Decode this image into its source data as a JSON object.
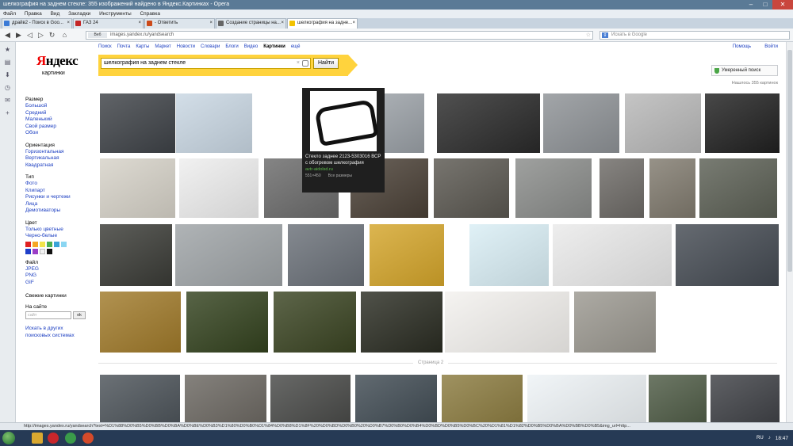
{
  "window": {
    "title": "шелкография на заднем стекле: 355 изображений найдено в Яндекс.Картинках - Opera"
  },
  "menu": [
    "Файл",
    "Правка",
    "Вид",
    "Закладки",
    "Инструменты",
    "Справка"
  ],
  "tabs": [
    {
      "label": "драйв2 - Поиск в Goo...",
      "color": "#3a7ad6"
    },
    {
      "label": "ГАЗ 24",
      "color": "#c42525"
    },
    {
      "label": "- Ответить",
      "color": "#cc4a1a"
    },
    {
      "label": "Создание страницы на...",
      "color": "#666666"
    },
    {
      "label": "шелкография на задне...",
      "color": "#f2c200",
      "active": true
    }
  ],
  "address": {
    "badge": "Веб",
    "url": "images.yandex.ru/yandsearch",
    "websearch_placeholder": "Искать в Google"
  },
  "yandex": {
    "logo_first": "Я",
    "logo_rest": "ндекс",
    "logo_sub": "картинки",
    "services": [
      "Поиск",
      "Почта",
      "Карты",
      "Маркет",
      "Новости",
      "Словари",
      "Блоги",
      "Видео",
      "Картинки",
      "ещё"
    ],
    "active_service": "Картинки",
    "help": "Помощь",
    "login": "Войти",
    "query": "шелкография на заднем стекле",
    "find_button": "Найти",
    "safe_search": "Умеренный поиск",
    "found": "Нашлось 355 картинок"
  },
  "sidebar": {
    "size_title": "Размер",
    "size_items": [
      "Большой",
      "Средний",
      "Маленький",
      "Свой размер",
      "Обои"
    ],
    "orient_title": "Ориентация",
    "orient_items": [
      "Горизонтальная",
      "Вертикальная",
      "Квадратная"
    ],
    "type_title": "Тип",
    "type_items": [
      "Фото",
      "Клипарт",
      "Рисунки и чертежи",
      "Лица",
      "Демотиваторы"
    ],
    "color_title": "Цвет",
    "color_items": [
      "Только цветные",
      "Черно-белые"
    ],
    "swatch_colors": [
      "#e02020",
      "#f5a623",
      "#f3e44a",
      "#4caf50",
      "#3aa3d8",
      "#8bd6f2",
      "#1f3fc9",
      "#9b3fc7",
      "#f2f2f2",
      "#111111"
    ],
    "file_title": "Файл",
    "file_items": [
      "JPEG",
      "PNG",
      "GIF"
    ],
    "similar": "Свежие картинки",
    "site_title": "На сайте",
    "site_placeholder": "сайт",
    "site_button": "ok",
    "other_systems": "Искать в других поисковых системах"
  },
  "tooltip": {
    "caption": "Стекло заднее 2123-5303016 ВСР с обогревом шелкография",
    "source": "avtr-aidolsd.ru",
    "meta1": "551×450",
    "meta2": "Все размеры"
  },
  "page2_label": "Страница 2",
  "status_url": "http://images.yandex.ru/yandsearch?text=%D1%88%D0%B5%D0%BB%D0%BA%D0%BE%D0%B3%D1%80%D0%B0%D1%84%D0%B8%D1%8F%20%D0%BD%D0%B0%20%D0%B7%D0%B0%D0%B4%D0%BD%D0%B5%D0%BC%20%D1%81%D1%82%D0%B5%D0%BA%D0%BB%D0%B5&img_url=http...",
  "clock": "18:47",
  "tray_lang": "RU",
  "thumbs": [
    {
      "c": "#3e4247"
    },
    {
      "c": "#c9d7e3"
    },
    {
      "c": "#9aa0a6"
    },
    {
      "c": "#2a2a2a"
    },
    {
      "c": "#8e9296"
    },
    {
      "c": "#b8b8b8"
    },
    {
      "c": "#202020"
    },
    {
      "c": "#f2f2f2"
    },
    {
      "c": "#d6d2c8"
    },
    {
      "c": "#eeeeee"
    },
    {
      "c": "#6a6a6a"
    },
    {
      "c": "#4a4036"
    },
    {
      "c": "#5a5750"
    },
    {
      "c": "#8a8c8a"
    },
    {
      "c": "#6d6a66"
    },
    {
      "c": "#807a6e"
    },
    {
      "c": "#5b5f54"
    },
    {
      "c": "#3a3b36"
    },
    {
      "c": "#9ea3a6"
    },
    {
      "c": "#6a7078"
    },
    {
      "c": "#d4a52a"
    },
    {
      "c": "#d9eef5"
    },
    {
      "c": "#eaeaea"
    },
    {
      "c": "#444a52"
    },
    {
      "c": "#a07a2a"
    },
    {
      "c": "#33421e"
    },
    {
      "c": "#3a4422"
    },
    {
      "c": "#2a2c22"
    },
    {
      "c": "#f3f1ee"
    },
    {
      "c": "#9b9890"
    },
    {
      "c": "#4b5258"
    },
    {
      "c": "#6a6660"
    },
    {
      "c": "#474846"
    },
    {
      "c": "#3f4a52"
    },
    {
      "c": "#8a7a3e"
    },
    {
      "c": "#eef3f6"
    },
    {
      "c": "#4d5a44"
    },
    {
      "c": "#3d3f44"
    }
  ]
}
